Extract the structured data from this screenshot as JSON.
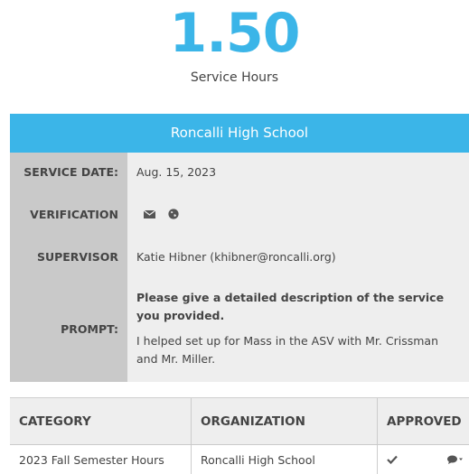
{
  "summary": {
    "hours_value": "1.50",
    "hours_label": "Service Hours"
  },
  "record": {
    "school": "Roncalli High School",
    "rows": {
      "service_date_label": "SERVICE DATE:",
      "service_date_value": "Aug. 15, 2023",
      "verification_label": "VERIFICATION",
      "verification_icons": [
        "envelope-icon",
        "globe-icon"
      ],
      "supervisor_label": "SUPERVISOR",
      "supervisor_value": "Katie Hibner (khibner@roncalli.org)",
      "prompt_label": "PROMPT:",
      "prompt_question": "Please give a detailed description of the service you provided.",
      "prompt_answer": "I helped set up for Mass in the ASV with Mr. Crissman and Mr. Miller."
    }
  },
  "table": {
    "headers": [
      "CATEGORY",
      "ORGANIZATION",
      "APPROVED"
    ],
    "rows": [
      {
        "category": "2023 Fall Semester Hours",
        "organization": "Roncalli High School",
        "approved_icon": "checkmark-icon",
        "action_icon": "comment-dropdown-icon"
      }
    ]
  },
  "colors": {
    "accent": "#3bb5e8",
    "label_bg": "#c9c9c9",
    "value_bg": "#eeeeee"
  }
}
